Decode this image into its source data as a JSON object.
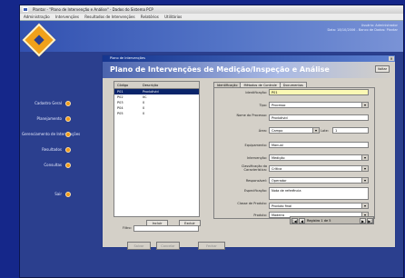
{
  "app": {
    "title": "Plantar - \"Plano de Intervenção e Análise\" - Dados do Sistema PCP",
    "menu": [
      "Administração",
      "Intervenções",
      "Resultados de Intervenções",
      "Relatórios",
      "Utilitários"
    ],
    "banner_info_1": "Usuário: Administrador",
    "banner_info_2": "Data: 18/10/2006 - Banco de Dados: Plantar"
  },
  "sidebar": {
    "items": [
      {
        "label": "Cadastro Geral"
      },
      {
        "label": "Planejamento"
      },
      {
        "label": "Gerenciamento de Intervenções"
      },
      {
        "label": "Resultados"
      },
      {
        "label": "Consultas"
      },
      {
        "label": "Sair"
      }
    ]
  },
  "form": {
    "window_title": "Plano de Intervenções",
    "heading": "Plano de Intervenções de Medição/Inspeção e Análise",
    "back_label": "Voltar",
    "list": {
      "headers": [
        "Código",
        "Descrição"
      ],
      "rows": [
        [
          "P01",
          "Produtivid"
        ],
        [
          "P02",
          "IIC"
        ],
        [
          "P03",
          "0"
        ],
        [
          "P04",
          "0"
        ],
        [
          "P05",
          "0"
        ]
      ],
      "incluir_label": "Incluir",
      "excluir_label": "Excluir",
      "filter_label": "Filtro:",
      "filter_value": ""
    },
    "tabs": [
      "Identificação",
      "Métodos de Controle",
      "Documentos"
    ],
    "fields": {
      "identificacao_label": "Identificação:",
      "identificacao_value": "P01",
      "tipo_label": "Tipo:",
      "tipo_value": "Processo",
      "nome_label": "Nome do Processo:",
      "nome_value": "Produtivid",
      "area_label": "Área:",
      "area_value": "Campo",
      "lote_label": "Lote:",
      "lote_value": "1",
      "equipamento_label": "Equipamento:",
      "equipamento_value": "Manual",
      "intervencao_label": "Intervenção:",
      "intervencao_value": "Medição",
      "classificacao_label": "Classificação da Característica:",
      "classificacao_value": "Crítica",
      "responsavel_label": "Responsável:",
      "responsavel_value": "Operador",
      "especificacao_label": "Especificação:",
      "especificacao_value": "Nota de referência",
      "classe_label": "Classe de Produto:",
      "classe_value": "Produto final",
      "produto_label": "Produto:",
      "produto_value": "Madeira"
    },
    "bottom_buttons": [
      "Salvar",
      "Cancelar",
      "Fechar"
    ],
    "nav": {
      "text": "Registro 1 de 5",
      "first": "|◀",
      "prev": "◀",
      "next": "▶",
      "last": "▶|"
    }
  },
  "colors": {
    "desktop": "#15278a",
    "accent": "#f09a1a",
    "selection": "#0a246a",
    "input_highlight": "#fbf8b4"
  }
}
